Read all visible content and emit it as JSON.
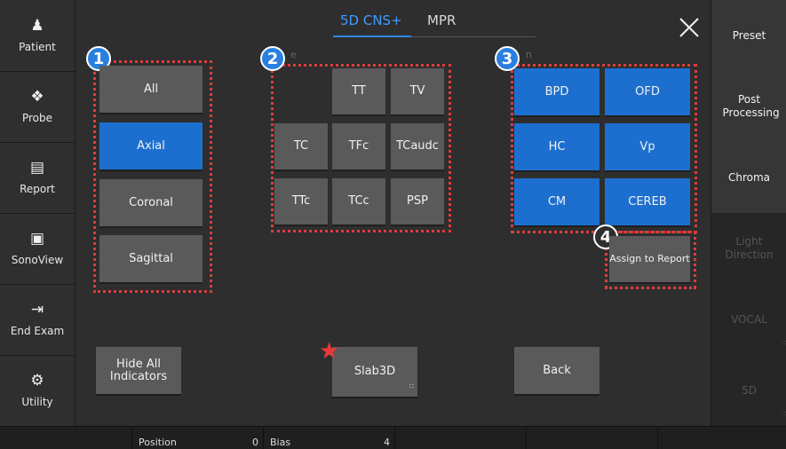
{
  "left_sidebar": {
    "items": [
      {
        "label": "Patient",
        "icon": "person-icon"
      },
      {
        "label": "Probe",
        "icon": "probe-icon"
      },
      {
        "label": "Report",
        "icon": "document-icon"
      },
      {
        "label": "SonoView",
        "icon": "image-search-icon"
      },
      {
        "label": "End Exam",
        "icon": "exit-icon"
      },
      {
        "label": "Utility",
        "icon": "gear-icon"
      }
    ]
  },
  "right_sidebar": {
    "items": [
      {
        "label": "Preset",
        "enabled": true
      },
      {
        "label": "Post Processing",
        "enabled": true
      },
      {
        "label": "Chroma",
        "enabled": true
      },
      {
        "label": "Light Direction",
        "enabled": false
      },
      {
        "label": "VOCAL",
        "enabled": false
      },
      {
        "label": "5D",
        "enabled": false
      }
    ]
  },
  "tabs": [
    {
      "label": "5D CNS+",
      "active": true
    },
    {
      "label": "MPR",
      "active": false
    }
  ],
  "plane_group": {
    "badge": "1",
    "buttons": [
      "All",
      "Axial",
      "Coronal",
      "Sagittal"
    ],
    "selected": "Axial"
  },
  "view_group": {
    "badge": "2",
    "hidden_label": "e",
    "buttons": [
      "TT",
      "TV",
      "TC",
      "TFc",
      "TCaudc",
      "TTc",
      "TCc",
      "PSP"
    ]
  },
  "measure_group": {
    "badge": "3",
    "hidden_label": "n",
    "buttons": [
      "BPD",
      "OFD",
      "HC",
      "Vp",
      "CM",
      "CEREB"
    ]
  },
  "assign_group": {
    "badge": "4",
    "button": "Assign to Report"
  },
  "bottom_buttons": {
    "hide_indicators": "Hide All Indicators",
    "slab3d": "Slab3D",
    "back": "Back"
  },
  "bottom_bar": {
    "position_label": "Position",
    "position_value": "0",
    "bias_label": "Bias",
    "bias_value": "4"
  },
  "colors": {
    "accent": "#1d6fcf",
    "highlight": "#e03b3b",
    "badge": "#2a80de"
  }
}
